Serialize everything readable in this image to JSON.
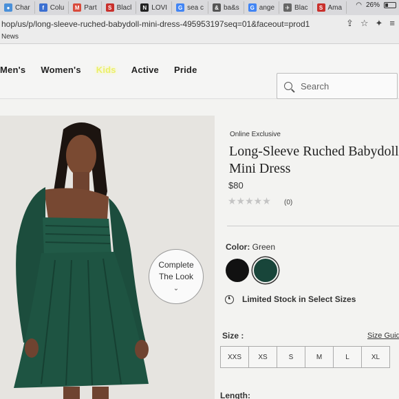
{
  "browser": {
    "tabs": [
      {
        "label": "Char",
        "icon": "chrome-icon",
        "color": "#4a90d9",
        "glyph": "●"
      },
      {
        "label": "Colu",
        "icon": "facebook-icon",
        "color": "#3b6fd1",
        "glyph": "f"
      },
      {
        "label": "Part",
        "icon": "gmail-icon",
        "color": "#d94b3c",
        "glyph": "M"
      },
      {
        "label": "Blacl",
        "icon": "site-s-icon",
        "color": "#c9302c",
        "glyph": "S"
      },
      {
        "label": "LOVI",
        "icon": "nyt-icon",
        "color": "#222222",
        "glyph": "N"
      },
      {
        "label": "sea c",
        "icon": "google-icon",
        "color": "#4285f4",
        "glyph": "G"
      },
      {
        "label": "ba&s",
        "icon": "ampersand-icon",
        "color": "#555555",
        "glyph": "&"
      },
      {
        "label": "ange",
        "icon": "google-icon",
        "color": "#4285f4",
        "glyph": "G"
      },
      {
        "label": "Blac",
        "icon": "plane-icon",
        "color": "#666666",
        "glyph": "✈"
      },
      {
        "label": "Ama",
        "icon": "site-s-icon",
        "color": "#c9302c",
        "glyph": "S"
      }
    ],
    "battery": "26%",
    "url": "hop/us/p/long-sleeve-ruched-babydoll-mini-dress-495953197seq=01&faceout=prod1",
    "bookmark": "News"
  },
  "nav": {
    "links": [
      "Men's",
      "Women's",
      "Kids",
      "Active",
      "Pride"
    ],
    "search_placeholder": "Search"
  },
  "product": {
    "complete_look": [
      "Complete",
      "The Look"
    ],
    "badge": "Online Exclusive",
    "title": "Long-Sleeve Ruched Babydoll Mini Dress",
    "price": "$80",
    "stars": "★★★★★",
    "review_count": "(0)",
    "color_label": "Color:",
    "color_value": "Green",
    "swatches": [
      {
        "name": "Black",
        "hex": "#111111"
      },
      {
        "name": "Green",
        "hex": "#18453a"
      }
    ],
    "stock_text": "Limited Stock in Select Sizes",
    "size_label": "Size :",
    "size_guide": "Size Guide",
    "sizes": [
      "XXS",
      "XS",
      "S",
      "M",
      "L",
      "XL"
    ],
    "length_label": "Length:"
  }
}
